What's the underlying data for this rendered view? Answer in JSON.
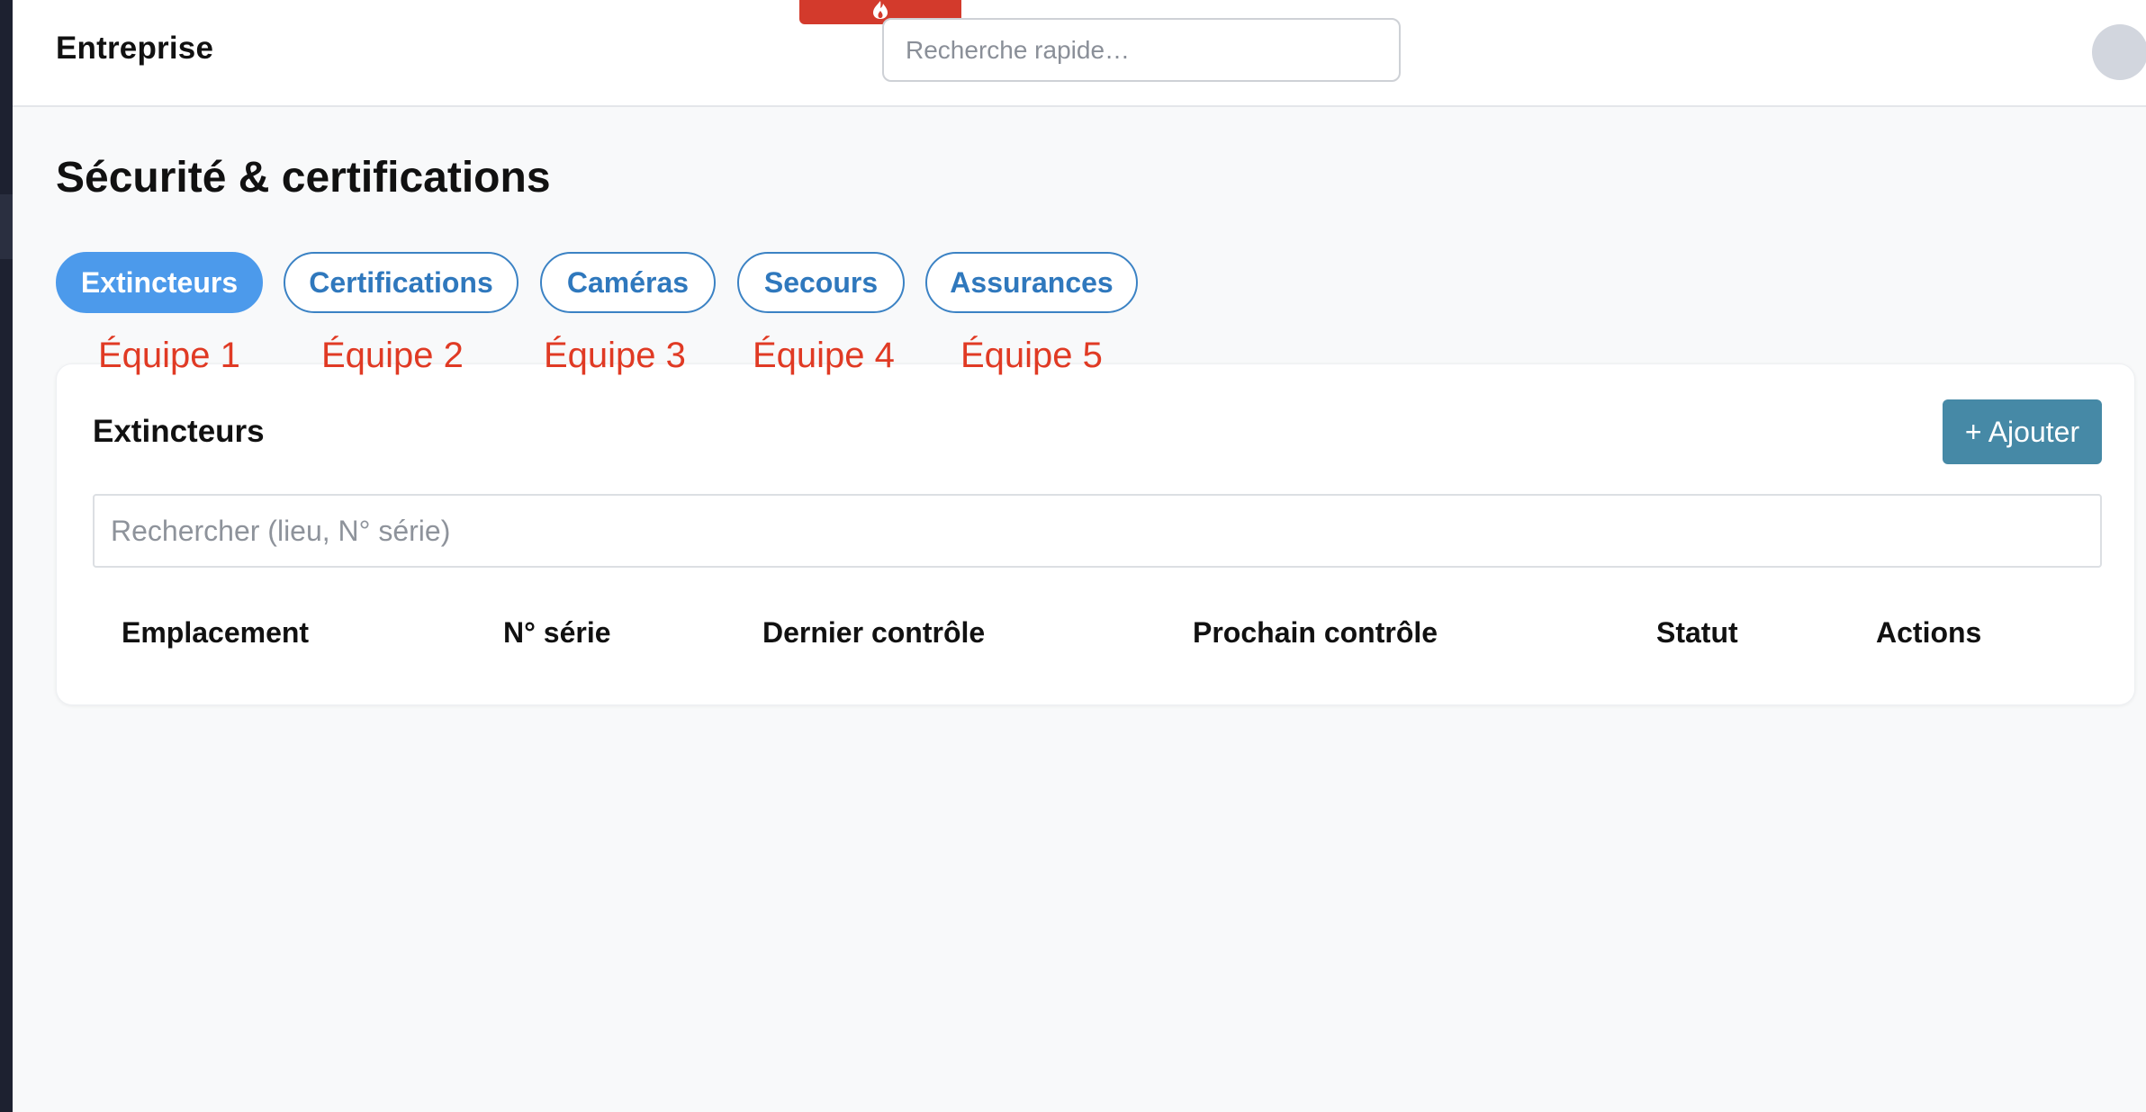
{
  "app": {
    "brand": "Entreprise",
    "quick_search_placeholder": "Recherche rapide…"
  },
  "page": {
    "title": "Sécurité & certifications"
  },
  "tabs": [
    {
      "label": "Extincteurs",
      "active": true
    },
    {
      "label": "Certifications",
      "active": false
    },
    {
      "label": "Caméras",
      "active": false
    },
    {
      "label": "Secours",
      "active": false
    },
    {
      "label": "Assurances",
      "active": false
    }
  ],
  "team_labels": [
    "Équipe 1",
    "Équipe 2",
    "Équipe 3",
    "Équipe 4",
    "Équipe 5"
  ],
  "panel": {
    "title": "Extincteurs",
    "add_button": "+ Ajouter",
    "search_placeholder": "Rechercher (lieu, N° série)",
    "columns": [
      "Emplacement",
      "N° série",
      "Dernier contrôle",
      "Prochain contrôle",
      "Statut",
      "Actions"
    ],
    "rows": []
  },
  "colors": {
    "accent_blue": "#4c9aeb",
    "tab_outline": "#3b82c4",
    "add_button": "#4689a6",
    "team_label_red": "#e03a24",
    "top_tab_red": "#d33a2c"
  },
  "icons": {
    "top_tab": "flame-icon"
  }
}
